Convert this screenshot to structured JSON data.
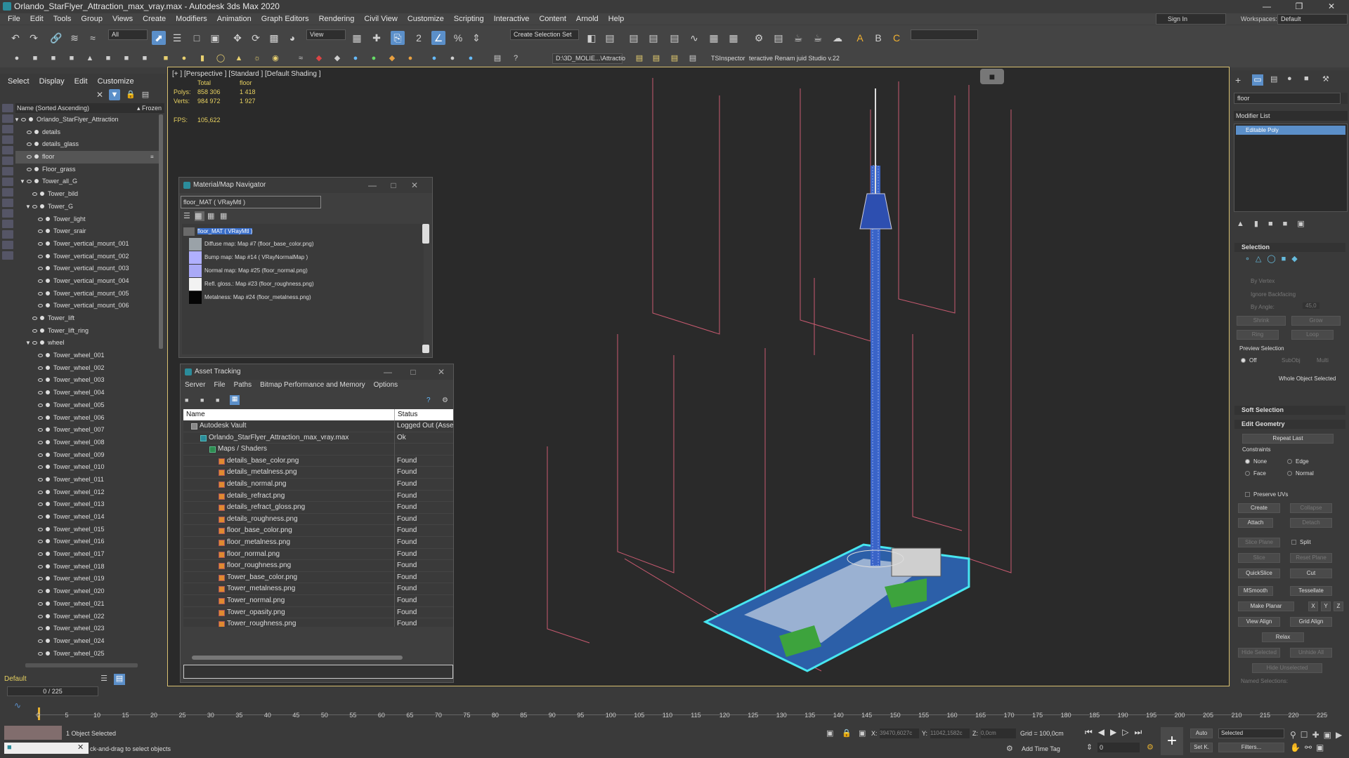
{
  "window": {
    "title": "Orlando_StarFlyer_Attraction_max_vray.max - Autodesk 3ds Max 2020"
  },
  "menu": [
    "File",
    "Edit",
    "Tools",
    "Group",
    "Views",
    "Create",
    "Modifiers",
    "Animation",
    "Graph Editors",
    "Rendering",
    "Civil View",
    "Customize",
    "Scripting",
    "Interactive",
    "Content",
    "Arnold",
    "Help"
  ],
  "account": {
    "signin": "Sign In",
    "workspaces_label": "Workspaces:",
    "workspace": "Default"
  },
  "toolbar": {
    "filter": "All",
    "refcoord": "View",
    "selection_set": "Create Selection Set",
    "path": "D:\\3D_MOLIE...\\Attractio",
    "ts_inspector": "TSInspector",
    "renamer": "teractive Renam juid Studio v.22"
  },
  "scene_explorer": {
    "tabs": [
      "Select",
      "Display",
      "Edit",
      "Customize"
    ],
    "header": "Name (Sorted Ascending)",
    "frozen": "▴ Frozen",
    "items": [
      {
        "label": "Orlando_StarFlyer_Attraction",
        "level": 0
      },
      {
        "label": "details",
        "level": 1
      },
      {
        "label": "details_glass",
        "level": 1
      },
      {
        "label": "floor",
        "level": 1,
        "selected": true
      },
      {
        "label": "Floor_grass",
        "level": 1
      },
      {
        "label": "Tower_all_G",
        "level": 1
      },
      {
        "label": "Tower_bild",
        "level": 2
      },
      {
        "label": "Tower_G",
        "level": 2
      },
      {
        "label": "Tower_light",
        "level": 3
      },
      {
        "label": "Tower_srair",
        "level": 3
      },
      {
        "label": "Tower_vertical_mount_001",
        "level": 3
      },
      {
        "label": "Tower_vertical_mount_002",
        "level": 3
      },
      {
        "label": "Tower_vertical_mount_003",
        "level": 3
      },
      {
        "label": "Tower_vertical_mount_004",
        "level": 3
      },
      {
        "label": "Tower_vertical_mount_005",
        "level": 3
      },
      {
        "label": "Tower_vertical_mount_006",
        "level": 3
      },
      {
        "label": "Tower_lift",
        "level": 2
      },
      {
        "label": "Tower_lift_ring",
        "level": 2
      },
      {
        "label": "wheel",
        "level": 2
      },
      {
        "label": "Tower_wheel_001",
        "level": 3
      },
      {
        "label": "Tower_wheel_002",
        "level": 3
      },
      {
        "label": "Tower_wheel_003",
        "level": 3
      },
      {
        "label": "Tower_wheel_004",
        "level": 3
      },
      {
        "label": "Tower_wheel_005",
        "level": 3
      },
      {
        "label": "Tower_wheel_006",
        "level": 3
      },
      {
        "label": "Tower_wheel_007",
        "level": 3
      },
      {
        "label": "Tower_wheel_008",
        "level": 3
      },
      {
        "label": "Tower_wheel_009",
        "level": 3
      },
      {
        "label": "Tower_wheel_010",
        "level": 3
      },
      {
        "label": "Tower_wheel_011",
        "level": 3
      },
      {
        "label": "Tower_wheel_012",
        "level": 3
      },
      {
        "label": "Tower_wheel_013",
        "level": 3
      },
      {
        "label": "Tower_wheel_014",
        "level": 3
      },
      {
        "label": "Tower_wheel_015",
        "level": 3
      },
      {
        "label": "Tower_wheel_016",
        "level": 3
      },
      {
        "label": "Tower_wheel_017",
        "level": 3
      },
      {
        "label": "Tower_wheel_018",
        "level": 3
      },
      {
        "label": "Tower_wheel_019",
        "level": 3
      },
      {
        "label": "Tower_wheel_020",
        "level": 3
      },
      {
        "label": "Tower_wheel_021",
        "level": 3
      },
      {
        "label": "Tower_wheel_022",
        "level": 3
      },
      {
        "label": "Tower_wheel_023",
        "level": 3
      },
      {
        "label": "Tower_wheel_024",
        "level": 3
      },
      {
        "label": "Tower_wheel_025",
        "level": 3
      }
    ],
    "layer": "Default",
    "frame_counter": "0 / 225"
  },
  "viewport": {
    "label": "[+ ] [Perspective ] [Standard ] [Default Shading ]",
    "stats_total": "Total",
    "stats_sel": "floor",
    "polys_label": "Polys:",
    "polys_total": "858 306",
    "polys_sel": "1 418",
    "verts_label": "Verts:",
    "verts_total": "984 972",
    "verts_sel": "1 927",
    "fps_label": "FPS:",
    "fps": "105,622"
  },
  "material_navigator": {
    "title": "Material/Map Navigator",
    "field": "floor_MAT  ( VRayMtl )",
    "root": "floor_MAT  ( VRayMtl )",
    "maps": [
      {
        "label": "Diffuse map: Map #7 (floor_base_color.png)",
        "color": "#9aa2a8"
      },
      {
        "label": "Bump map: Map #14  ( VRayNormalMap )",
        "color": "#b0b0ff"
      },
      {
        "label": "Normal map: Map #25 (floor_normal.png)",
        "color": "#a9a9f6"
      },
      {
        "label": "Refl. gloss.: Map #23 (floor_roughness.png)",
        "color": "#f2f2f2"
      },
      {
        "label": "Metalness: Map #24 (floor_metalness.png)",
        "color": "#050505"
      }
    ]
  },
  "asset_tracking": {
    "title": "Asset Tracking",
    "menu": [
      "Server",
      "File",
      "Paths",
      "Bitmap Performance and Memory",
      "Options"
    ],
    "columns": [
      "Name",
      "Status"
    ],
    "rows": [
      {
        "name": "Autodesk Vault",
        "status": "Logged Out (Asset",
        "indent": 1,
        "icon": "vault"
      },
      {
        "name": "Orlando_StarFlyer_Attraction_max_vray.max",
        "status": "Ok",
        "indent": 2,
        "icon": "max"
      },
      {
        "name": "Maps / Shaders",
        "status": "",
        "indent": 3,
        "icon": "folder"
      },
      {
        "name": "details_base_color.png",
        "status": "Found",
        "indent": 4,
        "icon": "bitmap"
      },
      {
        "name": "details_metalness.png",
        "status": "Found",
        "indent": 4,
        "icon": "bitmap"
      },
      {
        "name": "details_normal.png",
        "status": "Found",
        "indent": 4,
        "icon": "bitmap"
      },
      {
        "name": "details_refract.png",
        "status": "Found",
        "indent": 4,
        "icon": "bitmap"
      },
      {
        "name": "details_refract_gloss.png",
        "status": "Found",
        "indent": 4,
        "icon": "bitmap"
      },
      {
        "name": "details_roughness.png",
        "status": "Found",
        "indent": 4,
        "icon": "bitmap"
      },
      {
        "name": "floor_base_color.png",
        "status": "Found",
        "indent": 4,
        "icon": "bitmap"
      },
      {
        "name": "floor_metalness.png",
        "status": "Found",
        "indent": 4,
        "icon": "bitmap"
      },
      {
        "name": "floor_normal.png",
        "status": "Found",
        "indent": 4,
        "icon": "bitmap"
      },
      {
        "name": "floor_roughness.png",
        "status": "Found",
        "indent": 4,
        "icon": "bitmap"
      },
      {
        "name": "Tower_base_color.png",
        "status": "Found",
        "indent": 4,
        "icon": "bitmap"
      },
      {
        "name": "Tower_metalness.png",
        "status": "Found",
        "indent": 4,
        "icon": "bitmap"
      },
      {
        "name": "Tower_normal.png",
        "status": "Found",
        "indent": 4,
        "icon": "bitmap"
      },
      {
        "name": "Tower_opasity.png",
        "status": "Found",
        "indent": 4,
        "icon": "bitmap"
      },
      {
        "name": "Tower_roughness.png",
        "status": "Found",
        "indent": 4,
        "icon": "bitmap"
      }
    ]
  },
  "command_panel": {
    "name_field": "floor",
    "modifier_list": "Modifier List",
    "stack_item": "Editable Poly",
    "selection": {
      "title": "Selection",
      "by_vertex": "By Vertex",
      "ignore_backfacing": "Ignore Backfacing",
      "by_angle": "By Angle:",
      "angle": "45,0",
      "shrink": "Shrink",
      "grow": "Grow",
      "ring": "Ring",
      "loop": "Loop",
      "preview_selection": "Preview Selection",
      "off": "Off",
      "subobj": "SubObj",
      "multi": "Multi",
      "whole_object": "Whole Object Selected"
    },
    "soft_selection": "Soft Selection",
    "edit_geometry": {
      "title": "Edit Geometry",
      "repeat_last": "Repeat Last",
      "constraints": "Constraints",
      "none": "None",
      "edge": "Edge",
      "face": "Face",
      "normal": "Normal",
      "preserve_uvs": "Preserve UVs",
      "create": "Create",
      "collapse": "Collapse",
      "attach": "Attach",
      "detach": "Detach",
      "slice_plane": "Slice Plane",
      "split": "Split",
      "slice": "Slice",
      "reset_plane": "Reset Plane",
      "quickslice": "QuickSlice",
      "cut": "Cut",
      "msmooth": "MSmooth",
      "tessellate": "Tessellate",
      "make_planar": "Make Planar",
      "x": "X",
      "y": "Y",
      "z": "Z",
      "view_align": "View Align",
      "grid_align": "Grid Align",
      "relax": "Relax",
      "hide_selected": "Hide Selected",
      "unhide_all": "Unhide All",
      "hide_unselected": "Hide Unselected",
      "named_selections": "Named Selections:"
    }
  },
  "timeline": {
    "ticks": [
      "0",
      "5",
      "10",
      "15",
      "20",
      "25",
      "30",
      "35",
      "40",
      "45",
      "50",
      "55",
      "60",
      "65",
      "70",
      "75",
      "80",
      "85",
      "90",
      "95",
      "100",
      "105",
      "110",
      "115",
      "120",
      "125",
      "130",
      "135",
      "140",
      "145",
      "150",
      "155",
      "160",
      "165",
      "170",
      "175",
      "180",
      "185",
      "190",
      "195",
      "200",
      "205",
      "210",
      "215",
      "220",
      "225"
    ]
  },
  "statusbar": {
    "selected": "1 Object Selected",
    "prompt": "ck-and-drag to select objects",
    "x_label": "X:",
    "x": "39470,6027c",
    "y_label": "Y:",
    "y": "11042,1582c",
    "z_label": "Z:",
    "z": "0,0cm",
    "grid": "Grid = 100,0cm",
    "add_time_tag": "Add Time Tag",
    "auto": "Auto",
    "setk": "Set K.",
    "selected_combo": "Selected",
    "frame": "0",
    "filters": "Filters..."
  },
  "colors": {
    "accent": "#5b8fc9",
    "viewport_border": "#d8c070",
    "stats": "#e6d060",
    "tower": "#3a64c8",
    "frame_lines": "#c85a70"
  }
}
